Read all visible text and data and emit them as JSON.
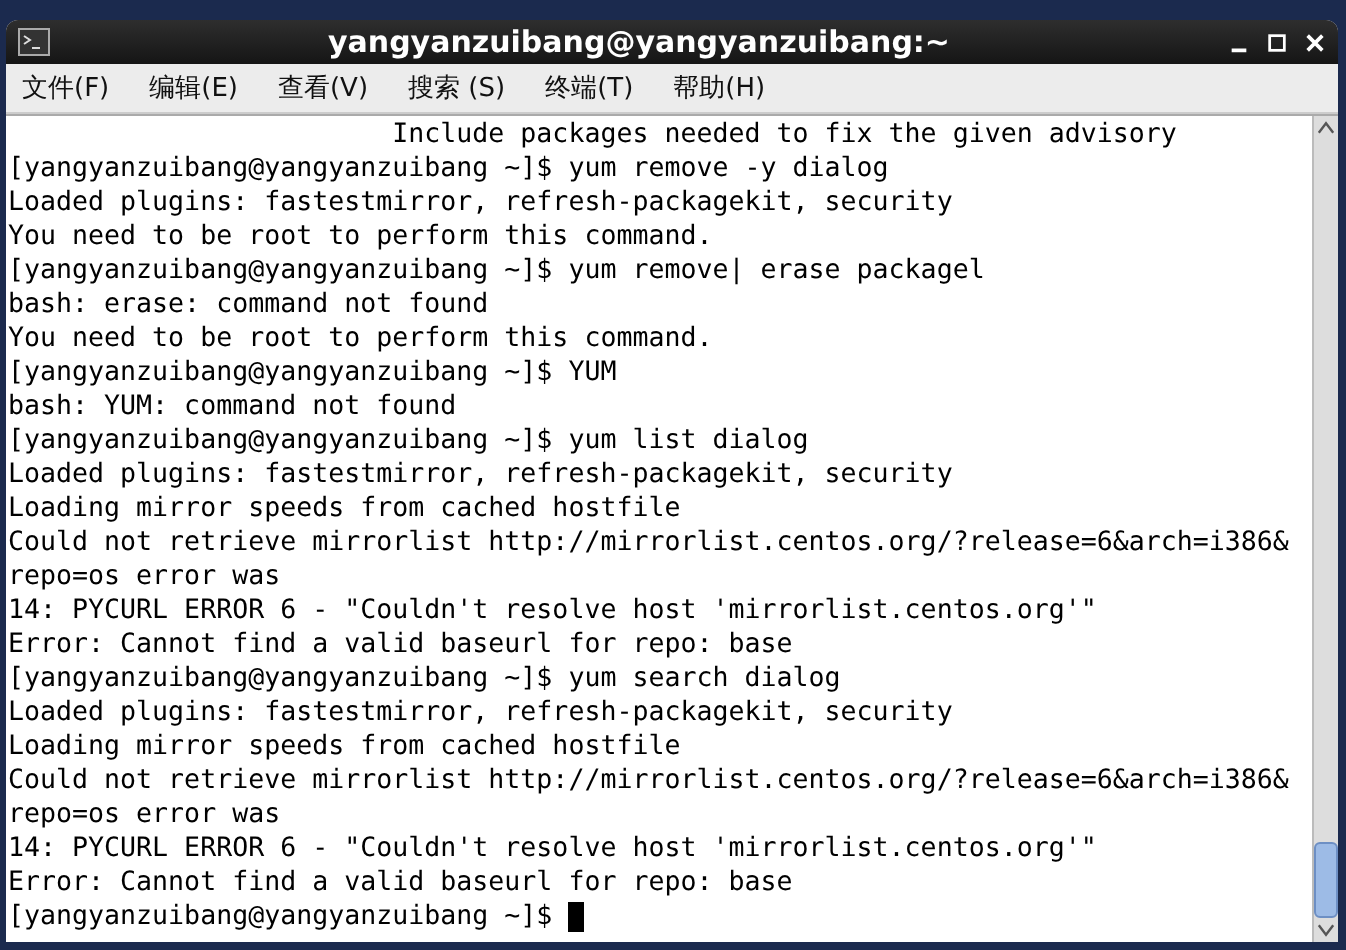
{
  "window": {
    "title": "yangyanzuibang@yangyanzuibang:~"
  },
  "menu": [
    "文件(F)",
    "编辑(E)",
    "查看(V)",
    "搜索 (S)",
    "终端(T)",
    "帮助(H)"
  ],
  "terminal": {
    "lines": [
      "                        Include packages needed to fix the given advisory",
      "[yangyanzuibang@yangyanzuibang ~]$ yum remove -y dialog",
      "Loaded plugins: fastestmirror, refresh-packagekit, security",
      "You need to be root to perform this command.",
      "[yangyanzuibang@yangyanzuibang ~]$ yum remove| erase packagel",
      "bash: erase: command not found",
      "You need to be root to perform this command.",
      "[yangyanzuibang@yangyanzuibang ~]$ YUM",
      "bash: YUM: command not found",
      "[yangyanzuibang@yangyanzuibang ~]$ yum list dialog",
      "Loaded plugins: fastestmirror, refresh-packagekit, security",
      "Loading mirror speeds from cached hostfile",
      "Could not retrieve mirrorlist http://mirrorlist.centos.org/?release=6&arch=i386&",
      "repo=os error was",
      "14: PYCURL ERROR 6 - \"Couldn't resolve host 'mirrorlist.centos.org'\"",
      "Error: Cannot find a valid baseurl for repo: base",
      "[yangyanzuibang@yangyanzuibang ~]$ yum search dialog",
      "Loaded plugins: fastestmirror, refresh-packagekit, security",
      "Loading mirror speeds from cached hostfile",
      "Could not retrieve mirrorlist http://mirrorlist.centos.org/?release=6&arch=i386&",
      "repo=os error was",
      "14: PYCURL ERROR 6 - \"Couldn't resolve host 'mirrorlist.centos.org'\"",
      "Error: Cannot find a valid baseurl for repo: base",
      "[yangyanzuibang@yangyanzuibang ~]$ "
    ]
  }
}
